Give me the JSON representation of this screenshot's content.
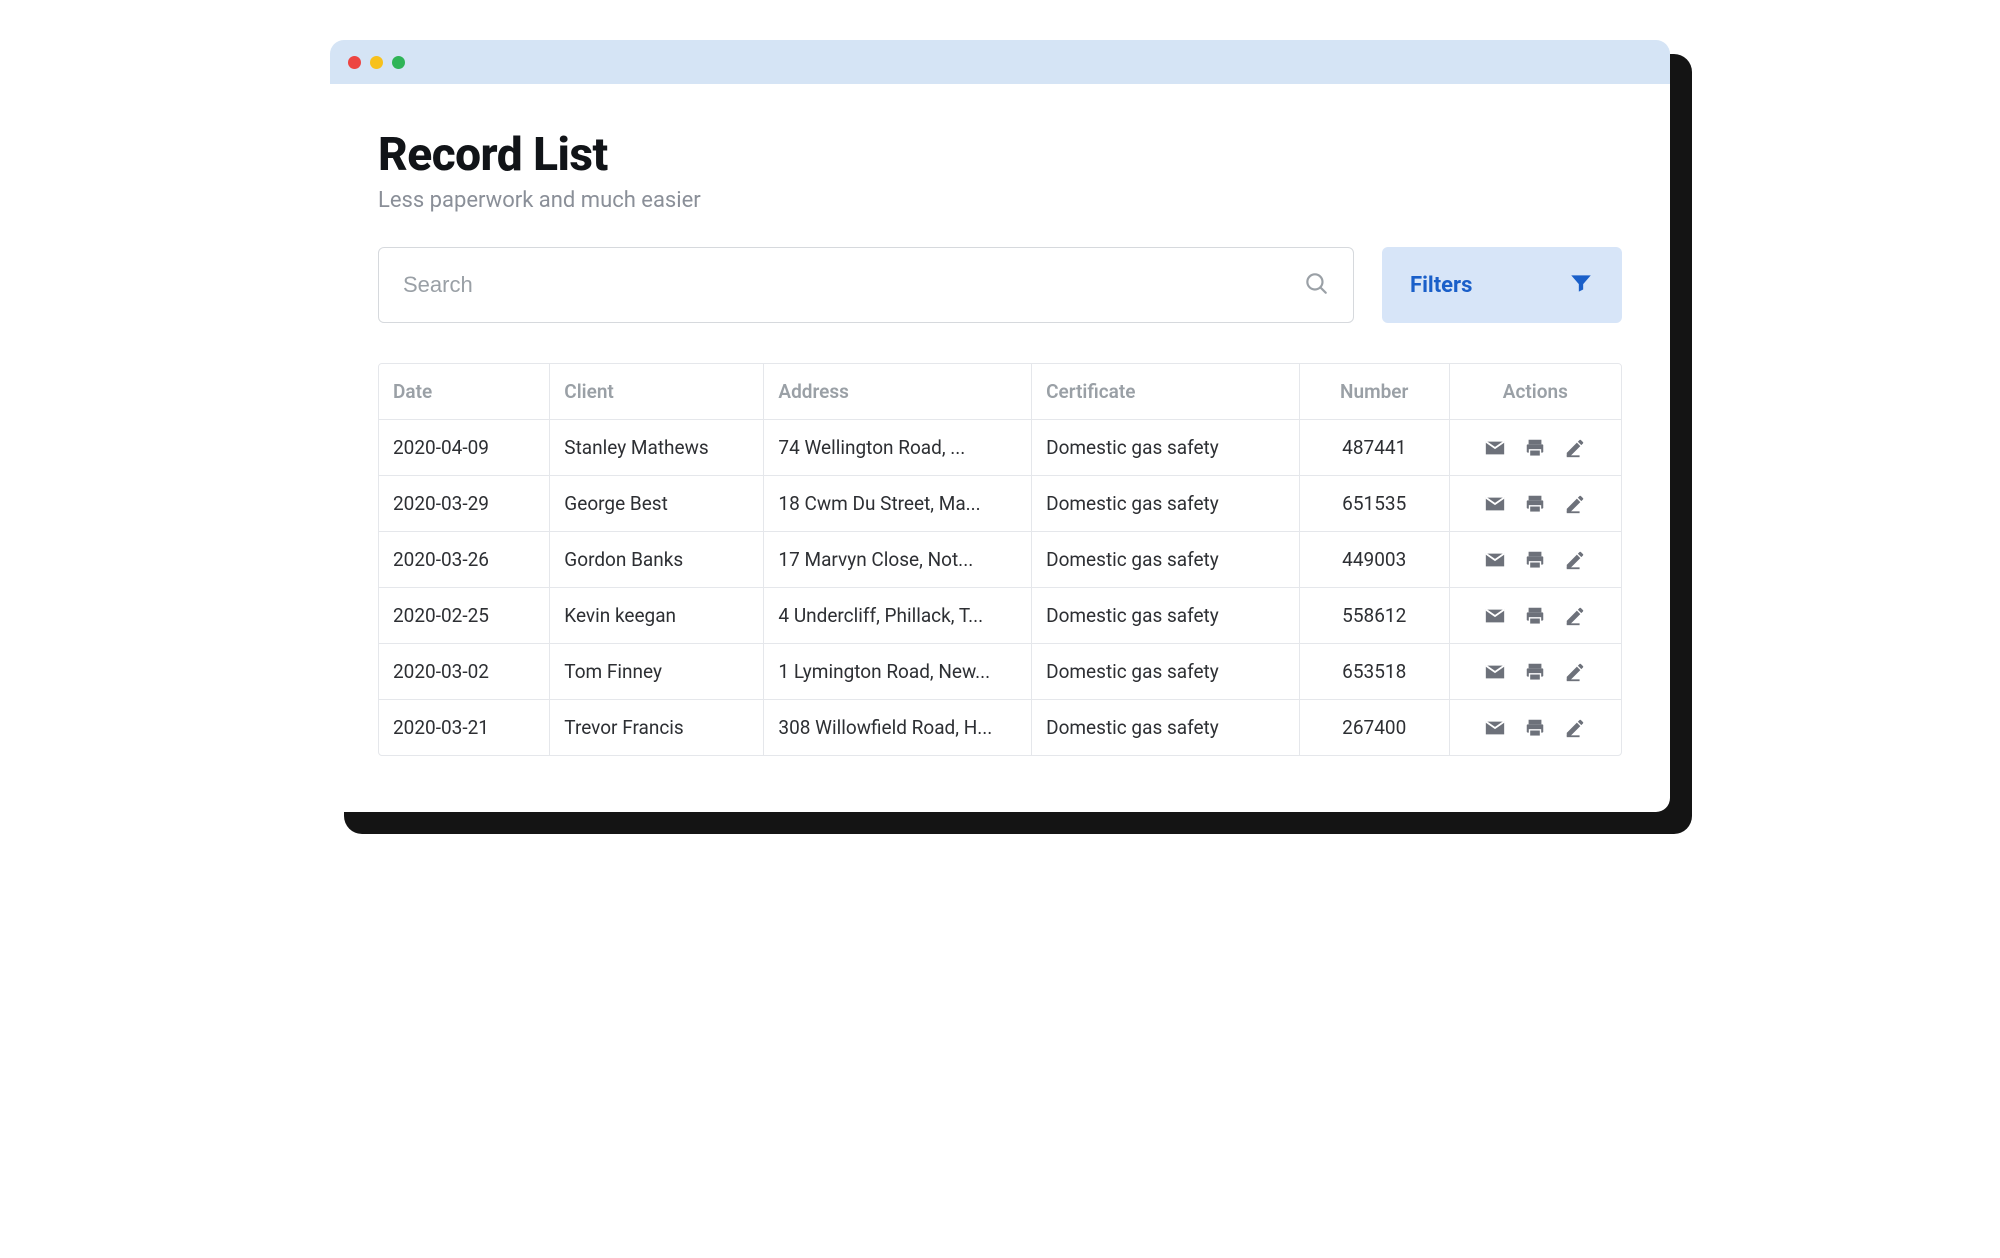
{
  "header": {
    "title": "Record List",
    "subtitle": "Less paperwork and much easier"
  },
  "search": {
    "placeholder": "Search",
    "value": ""
  },
  "filters": {
    "label": "Filters"
  },
  "columns": {
    "date": "Date",
    "client": "Client",
    "address": "Address",
    "certificate": "Certificate",
    "number": "Number",
    "actions": "Actions"
  },
  "rows": [
    {
      "date": "2020-04-09",
      "client": "Stanley Mathews",
      "address": "74 Wellington Road, ...",
      "certificate": "Domestic gas safety",
      "number": "487441"
    },
    {
      "date": "2020-03-29",
      "client": "George Best",
      "address": "18 Cwm Du Street, Ma...",
      "certificate": "Domestic gas safety",
      "number": "651535"
    },
    {
      "date": "2020-03-26",
      "client": "Gordon Banks",
      "address": "17 Marvyn Close, Not...",
      "certificate": "Domestic gas safety",
      "number": "449003"
    },
    {
      "date": "2020-02-25",
      "client": "Kevin keegan",
      "address": "4 Undercliff, Phillack, T...",
      "certificate": "Domestic gas safety",
      "number": "558612"
    },
    {
      "date": "2020-03-02",
      "client": "Tom Finney",
      "address": "1 Lymington Road, New...",
      "certificate": "Domestic gas safety",
      "number": "653518"
    },
    {
      "date": "2020-03-21",
      "client": "Trevor Francis",
      "address": "308 Willowfield Road, H...",
      "certificate": "Domestic gas safety",
      "number": "267400"
    }
  ]
}
